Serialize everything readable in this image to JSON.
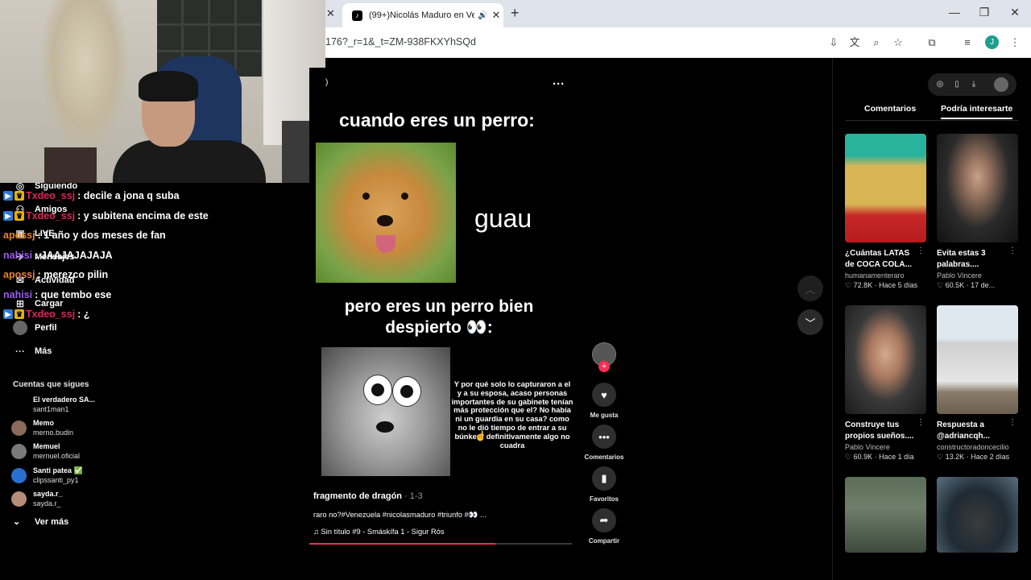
{
  "browser": {
    "tab_title": "(99+)Nicolás Maduro en Ve",
    "url": "176?_r=1&_t=ZM-938FKXYhSQd",
    "profile_initial": "J"
  },
  "sidebar": {
    "items": [
      {
        "label": "Siguiendo",
        "icon": "following-icon"
      },
      {
        "label": "Amigos",
        "icon": "friends-icon"
      },
      {
        "label": "LIVE",
        "icon": "live-icon"
      },
      {
        "label": "Mensajes",
        "icon": "messages-icon"
      },
      {
        "label": "Actividad",
        "icon": "activity-icon"
      },
      {
        "label": "Cargar",
        "icon": "upload-icon"
      },
      {
        "label": "Perfil",
        "icon": "profile-icon"
      },
      {
        "label": "Más",
        "icon": "more-icon"
      }
    ],
    "following_header": "Cuentas que sigues",
    "accounts": [
      {
        "name": "El verdadero SA...",
        "handle": "sant1man1",
        "color": "#000000"
      },
      {
        "name": "Memo",
        "handle": "merno.budin",
        "color": "#8a6b5a"
      },
      {
        "name": "Memuel",
        "handle": "mernuel.oficial",
        "color": "#7a7a7a"
      },
      {
        "name": "Santi patea ✅",
        "handle": "clipssanti_py1",
        "color": "#2a6fd0"
      },
      {
        "name": "sayda.r_",
        "handle": "sayda.r_",
        "color": "#b58c78"
      }
    ],
    "see_more": "Ver más"
  },
  "chat": [
    {
      "user": "Txdeo_ssj",
      "msg": ": decile a jona q suba",
      "color": "#e0245e",
      "badges": true
    },
    {
      "user": "Txdeo_ssj",
      "msg": ": y subitena encima de este",
      "color": "#e0245e",
      "badges": true
    },
    {
      "user": "apossj",
      "msg": ": 1 año y dos meses de fan",
      "color": "#e8871e",
      "badges": false
    },
    {
      "user": "nahisi",
      "msg": ": JAAJAJAJAJA",
      "color": "#9b5de5",
      "badges": false
    },
    {
      "user": "apossj",
      "msg": ": merezco pilin",
      "color": "#e8871e",
      "badges": false
    },
    {
      "user": "nahisi",
      "msg": ": que tembo ese",
      "color": "#9b5de5",
      "badges": false
    },
    {
      "user": "Txdeo_ssj",
      "msg": ": ¿",
      "color": "#e0245e",
      "badges": true
    }
  ],
  "video": {
    "paren": ")",
    "meme_line1": "cuando eres un perro:",
    "meme_guau": "guau",
    "meme_line2": "pero eres un perro bien despierto 👀:",
    "meme_caption": "Y por qué solo lo capturaron a el y a su esposa, acaso personas importantes de su gabinete tenían más protección que el? No había ni un guardia en su casa? como no le dió tiempo de entrar a su búnker? definitivamente algo no cuadra",
    "title": "fragmento de dragón",
    "part": " · 1-3",
    "description": "raro no?#Venezuela #nicolasmaduro #triunfo #👀 ...",
    "music": "♫  Sin título #9 - Smáskífa 1 - Sigur Rós",
    "progress": 0.71
  },
  "actions": {
    "like": "Me gusta",
    "comments": "Comentarios",
    "favorites": "Favoritos",
    "share": "Compartir"
  },
  "right": {
    "tab_comments": "Comentarios",
    "tab_suggest": "Podría interesarte",
    "cards": [
      {
        "title": "¿Cuántas LATAS de COCA COLA...",
        "author": "humanamenteraro",
        "stats": "♡ 72.8K · Hace 5 días",
        "thumb": "skeleton"
      },
      {
        "title": "Evita estas 3 palabras....",
        "author": "Pablo Vincere",
        "stats": "♡ 60.5K · 17 de...",
        "thumb": "man"
      },
      {
        "title": "Construye tus propios sueños....",
        "author": "Pablo Vincere",
        "stats": "♡ 60.9K · Hace 1 día",
        "thumb": "man2"
      },
      {
        "title": "Respuesta a @adriancqh...",
        "author": "constructoradoncecilio",
        "stats": "♡ 13.2K · Hace 2 días",
        "thumb": "house"
      },
      {
        "title": "",
        "author": "",
        "stats": "",
        "thumb": "hill"
      },
      {
        "title": "",
        "author": "",
        "stats": "",
        "thumb": "batman"
      }
    ]
  }
}
